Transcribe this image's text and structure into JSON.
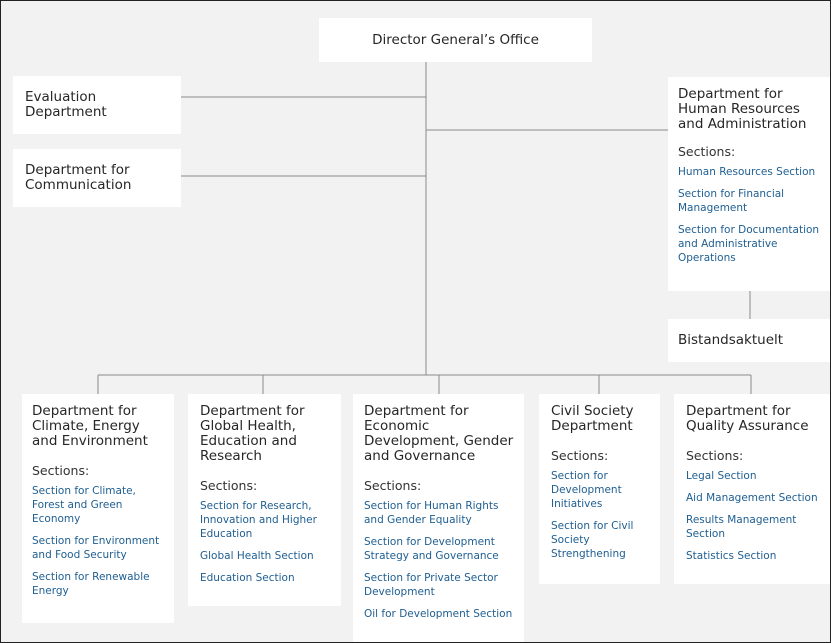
{
  "director": {
    "title": "Director General’s Office"
  },
  "left_departments": [
    {
      "title": "Evaluation Department"
    },
    {
      "title": "Department for Communication"
    }
  ],
  "hr_department": {
    "title": "Department for Human Resources and Administration",
    "sections_label": "Sections:",
    "sections": [
      "Human Resources Section",
      "Section for Financial Management",
      "Section for Documentation and Administrative Operations"
    ]
  },
  "bistand": {
    "title": "Bistandsaktuelt"
  },
  "bottom_departments": [
    {
      "title": "Department for Climate, Energy and Environment",
      "sections_label": "Sections:",
      "sections": [
        "Section for Climate, Forest and Green Economy",
        "Section for Environment and Food Security",
        "Section for Renewable Energy"
      ]
    },
    {
      "title": "Department for Global Health, Education and Research",
      "sections_label": "Sections:",
      "sections": [
        "Section for Research, Innovation and Higher Education",
        "Global Health Section",
        "Education Section"
      ]
    },
    {
      "title": "Department for Economic Development, Gender and Governance",
      "sections_label": "Sections:",
      "sections": [
        "Section for Human Rights and Gender Equality",
        "Section for Development Strategy and Governance",
        "Section for Private Sector Development",
        "Oil for Development Section"
      ]
    },
    {
      "title": "Civil Society Department",
      "sections_label": "Sections:",
      "sections": [
        "Section for Development Initiatives",
        "Section for Civil Society Strengthening"
      ]
    },
    {
      "title": "Department for Quality Assurance",
      "sections_label": "Sections:",
      "sections": [
        "Legal Section",
        "Aid Management Section",
        "Results Management Section",
        "Statistics Section"
      ]
    }
  ],
  "colors": {
    "background": "#f2f2f2",
    "box": "#ffffff",
    "connector": "#8a8a8a",
    "link": "#1e5e91",
    "title": "#262626"
  }
}
